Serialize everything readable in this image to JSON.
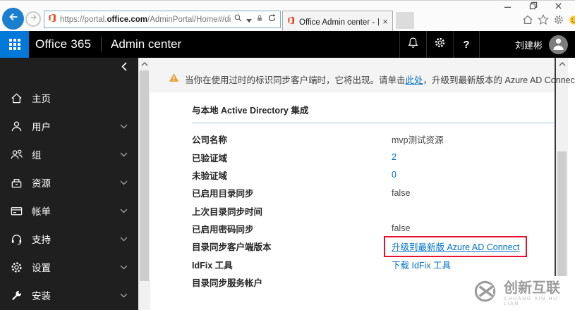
{
  "browser": {
    "url_prefix": "https://portal.",
    "url_domain": "office.com",
    "url_path": "/AdminPortal/Home#/dirsyncmanagement",
    "tab_title": "Office Admin center - 目录...",
    "tab_close": "×"
  },
  "header": {
    "brand": "Office 365",
    "section": "Admin center",
    "help_label": "?",
    "user_name": "刘建彬"
  },
  "sidebar": {
    "items": [
      {
        "label": "主页",
        "icon": "home-icon",
        "expandable": false
      },
      {
        "label": "用户",
        "icon": "users-icon",
        "expandable": true
      },
      {
        "label": "组",
        "icon": "groups-icon",
        "expandable": true
      },
      {
        "label": "资源",
        "icon": "resources-icon",
        "expandable": true
      },
      {
        "label": "帐单",
        "icon": "billing-icon",
        "expandable": true
      },
      {
        "label": "支持",
        "icon": "support-icon",
        "expandable": true
      },
      {
        "label": "设置",
        "icon": "settings-icon",
        "expandable": true
      },
      {
        "label": "安装",
        "icon": "setup-icon",
        "expandable": true
      }
    ]
  },
  "main": {
    "warning": {
      "text_before": "当你在使用过时的标识同步客户端时，它将出现。请单击",
      "link_text": "此处",
      "text_after": "，升级到最新版本的 Azure AD Connect。"
    },
    "section_title": "与本地 Active Directory 集成",
    "rows": [
      {
        "label": "公司名称",
        "value": "mvp测试资源",
        "type": "text"
      },
      {
        "label": "已验证域",
        "value": "2",
        "type": "link"
      },
      {
        "label": "未验证域",
        "value": "0",
        "type": "link"
      },
      {
        "label": "已启用目录同步",
        "value": "false",
        "type": "text"
      },
      {
        "label": "上次目录同步时间",
        "value": "",
        "type": "text"
      },
      {
        "label": "已启用密码同步",
        "value": "false",
        "type": "text"
      },
      {
        "label": "目录同步客户端版本",
        "value": "升级到最新版 Azure AD Connect",
        "type": "link-underline",
        "highlighted": true
      },
      {
        "label": "IdFix 工具",
        "value": "下载 IdFix 工具",
        "type": "link"
      },
      {
        "label": "目录同步服务帐户",
        "value": "",
        "type": "text"
      }
    ]
  },
  "watermark": {
    "title": "创新互联",
    "subtitle": "CHUANG XIN HU LIAN"
  },
  "colors": {
    "launcher_blue": "#0078d7",
    "link_blue": "#0072c6",
    "highlight_red": "#e8112d",
    "warning_orange": "#e9a13b",
    "sidebar_bg": "#1f1f1f",
    "header_bg": "#000000"
  }
}
